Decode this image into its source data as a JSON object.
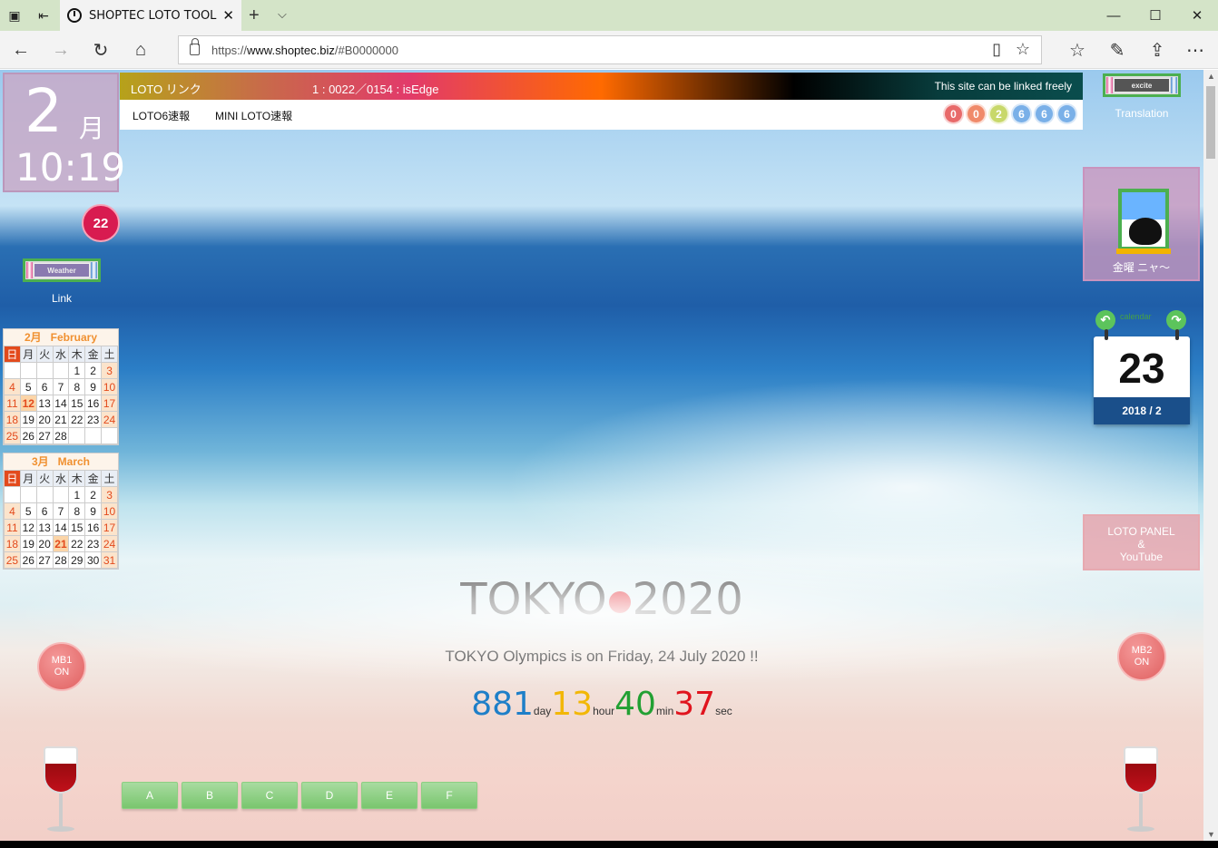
{
  "browser": {
    "tab_title": "SHOPTEC LOTO TOOL",
    "url_scheme": "https://",
    "url_host": "www.shoptec.biz",
    "url_path": "/#B0000000",
    "icons": [
      "tab-list-icon",
      "set-aside-icon",
      "back-icon",
      "forward-icon",
      "refresh-icon",
      "home-icon",
      "lock-icon",
      "reading-view-icon",
      "favorite-star-icon",
      "favorites-icon",
      "pen-icon",
      "share-icon",
      "more-icon",
      "minimize-icon",
      "maximize-icon",
      "close-icon"
    ]
  },
  "loto_bar": {
    "link_label": "LOTO リンク",
    "counter": "1 : 0022／0154 : isEdge",
    "linked_note": "This site can be linked freely",
    "loto6_label": "LOTO6速報",
    "mini_loto_label": "MINI LOTO速報",
    "balls": [
      {
        "value": "0",
        "color": "#e86a6a"
      },
      {
        "value": "0",
        "color": "#f08a6a"
      },
      {
        "value": "2",
        "color": "#c8d86a"
      },
      {
        "value": "6",
        "color": "#7ab0e8"
      },
      {
        "value": "6",
        "color": "#7ab0e8"
      },
      {
        "value": "6",
        "color": "#7ab0e8"
      }
    ]
  },
  "clock": {
    "month": "2",
    "month_suffix": "月",
    "time": "10:19"
  },
  "badge": "22",
  "weather": {
    "button_text": "Weather",
    "link_label": "Link"
  },
  "translation": {
    "button_text": "excite",
    "label": "Translation"
  },
  "calendars": [
    {
      "month_jp": "2月",
      "month_en": "February",
      "dow": [
        "日",
        "月",
        "火",
        "水",
        "木",
        "金",
        "土"
      ],
      "weeks": [
        [
          "",
          "",
          "",
          "",
          "1",
          "2",
          "3"
        ],
        [
          "4",
          "5",
          "6",
          "7",
          "8",
          "9",
          "10"
        ],
        [
          "11",
          "12",
          "13",
          "14",
          "15",
          "16",
          "17"
        ],
        [
          "18",
          "19",
          "20",
          "21",
          "22",
          "23",
          "24"
        ],
        [
          "25",
          "26",
          "27",
          "28",
          "",
          "",
          ""
        ]
      ],
      "highlight": "12"
    },
    {
      "month_jp": "3月",
      "month_en": "March",
      "dow": [
        "日",
        "月",
        "火",
        "水",
        "木",
        "金",
        "土"
      ],
      "weeks": [
        [
          "",
          "",
          "",
          "",
          "1",
          "2",
          "3"
        ],
        [
          "4",
          "5",
          "6",
          "7",
          "8",
          "9",
          "10"
        ],
        [
          "11",
          "12",
          "13",
          "14",
          "15",
          "16",
          "17"
        ],
        [
          "18",
          "19",
          "20",
          "21",
          "22",
          "23",
          "24"
        ],
        [
          "25",
          "26",
          "27",
          "28",
          "29",
          "30",
          "31"
        ]
      ],
      "highlight": "21"
    }
  ],
  "friday_panel": {
    "label": "金曜 ニャ〜"
  },
  "day_calendar": {
    "link": "calendar",
    "day": "23",
    "year_month": "2018 / 2"
  },
  "loto_panel": {
    "line1": "LOTO PANEL",
    "line2": "&",
    "line3": "YouTube"
  },
  "mb1": {
    "line1": "MB1",
    "line2": "ON"
  },
  "mb2": {
    "line1": "MB2",
    "line2": "ON"
  },
  "olympics": {
    "title_left": "TOKYO",
    "title_right": "2020",
    "subtitle": "TOKYO Olympics is on Friday, 24 July 2020 !!",
    "countdown": [
      {
        "value": "881",
        "unit": "day",
        "color": "#1e7fc8"
      },
      {
        "value": "13",
        "unit": "hour",
        "color": "#f2b705"
      },
      {
        "value": "40",
        "unit": "min",
        "color": "#22a033"
      },
      {
        "value": "37",
        "unit": "sec",
        "color": "#e0141e"
      }
    ]
  },
  "bottom_buttons": [
    "A",
    "B",
    "C",
    "D",
    "E",
    "F"
  ]
}
